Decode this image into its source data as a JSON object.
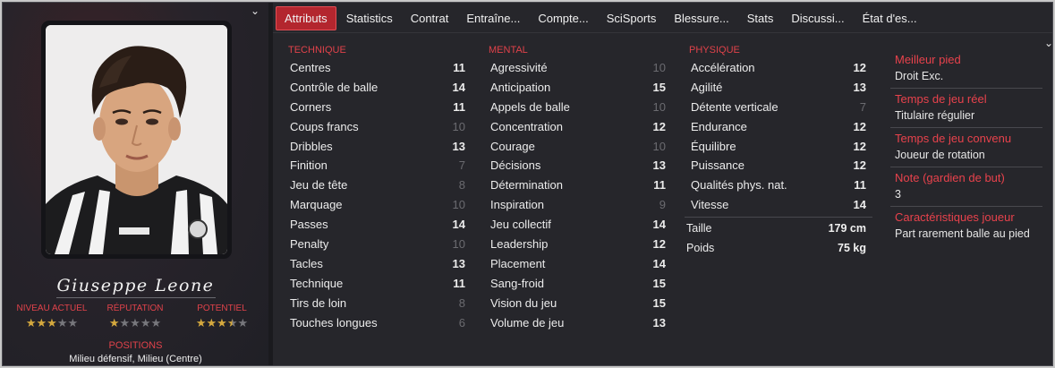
{
  "player": {
    "name": "Giuseppe Leone",
    "ratings": [
      {
        "label": "NIVEAU ACTUEL",
        "stars": 3,
        "of": 5
      },
      {
        "label": "RÉPUTATION",
        "stars": 1,
        "of": 5
      },
      {
        "label": "POTENTIEL",
        "stars": 3.5,
        "of": 5
      }
    ],
    "positions_label": "POSITIONS",
    "positions_value": "Milieu défensif, Milieu (Centre)"
  },
  "tabs": [
    {
      "label": "Attributs",
      "active": true
    },
    {
      "label": "Statistics",
      "active": false
    },
    {
      "label": "Contrat",
      "active": false
    },
    {
      "label": "Entraîne...",
      "active": false
    },
    {
      "label": "Compte...",
      "active": false
    },
    {
      "label": "SciSports",
      "active": false
    },
    {
      "label": "Blessure...",
      "active": false
    },
    {
      "label": "Stats",
      "active": false
    },
    {
      "label": "Discussi...",
      "active": false
    },
    {
      "label": "État d'es...",
      "active": false
    }
  ],
  "attributes": {
    "technique": {
      "title": "TECHNIQUE",
      "items": [
        {
          "name": "Centres",
          "value": 11,
          "dim": false
        },
        {
          "name": "Contrôle de balle",
          "value": 14,
          "dim": false
        },
        {
          "name": "Corners",
          "value": 11,
          "dim": false
        },
        {
          "name": "Coups francs",
          "value": 10,
          "dim": true
        },
        {
          "name": "Dribbles",
          "value": 13,
          "dim": false
        },
        {
          "name": "Finition",
          "value": 7,
          "dim": true
        },
        {
          "name": "Jeu de tête",
          "value": 8,
          "dim": true
        },
        {
          "name": "Marquage",
          "value": 10,
          "dim": true
        },
        {
          "name": "Passes",
          "value": 14,
          "dim": false
        },
        {
          "name": "Penalty",
          "value": 10,
          "dim": true
        },
        {
          "name": "Tacles",
          "value": 13,
          "dim": false
        },
        {
          "name": "Technique",
          "value": 11,
          "dim": false
        },
        {
          "name": "Tirs de loin",
          "value": 8,
          "dim": true
        },
        {
          "name": "Touches longues",
          "value": 6,
          "dim": true
        }
      ]
    },
    "mental": {
      "title": "MENTAL",
      "items": [
        {
          "name": "Agressivité",
          "value": 10,
          "dim": true
        },
        {
          "name": "Anticipation",
          "value": 15,
          "dim": false
        },
        {
          "name": "Appels de balle",
          "value": 10,
          "dim": true
        },
        {
          "name": "Concentration",
          "value": 12,
          "dim": false
        },
        {
          "name": "Courage",
          "value": 10,
          "dim": true
        },
        {
          "name": "Décisions",
          "value": 13,
          "dim": false
        },
        {
          "name": "Détermination",
          "value": 11,
          "dim": false
        },
        {
          "name": "Inspiration",
          "value": 9,
          "dim": true
        },
        {
          "name": "Jeu collectif",
          "value": 14,
          "dim": false
        },
        {
          "name": "Leadership",
          "value": 12,
          "dim": false
        },
        {
          "name": "Placement",
          "value": 14,
          "dim": false
        },
        {
          "name": "Sang-froid",
          "value": 15,
          "dim": false
        },
        {
          "name": "Vision du jeu",
          "value": 15,
          "dim": false
        },
        {
          "name": "Volume de jeu",
          "value": 13,
          "dim": false
        }
      ]
    },
    "physique": {
      "title": "PHYSIQUE",
      "items": [
        {
          "name": "Accélération",
          "value": 12,
          "dim": false
        },
        {
          "name": "Agilité",
          "value": 13,
          "dim": false
        },
        {
          "name": "Détente verticale",
          "value": 7,
          "dim": true
        },
        {
          "name": "Endurance",
          "value": 12,
          "dim": false
        },
        {
          "name": "Équilibre",
          "value": 12,
          "dim": false
        },
        {
          "name": "Puissance",
          "value": 12,
          "dim": false
        },
        {
          "name": "Qualités phys. nat.",
          "value": 11,
          "dim": false
        },
        {
          "name": "Vitesse",
          "value": 14,
          "dim": false
        }
      ],
      "extras": [
        {
          "name": "Taille",
          "value": "179 cm"
        },
        {
          "name": "Poids",
          "value": "75 kg"
        }
      ]
    }
  },
  "info": [
    {
      "label": "Meilleur pied",
      "value": "Droit Exc."
    },
    {
      "label": "Temps de jeu réel",
      "value": "Titulaire régulier"
    },
    {
      "label": "Temps de jeu convenu",
      "value": "Joueur de rotation"
    },
    {
      "label": "Note (gardien de but)",
      "value": "3"
    },
    {
      "label": "Caractéristiques joueur",
      "value": "Part rarement balle au pied"
    }
  ],
  "icons": {
    "collapse": "chevron-down-icon",
    "star": "star-icon"
  },
  "colors": {
    "accent": "#b3262e",
    "label_red": "#e0424a",
    "star_gold": "#d5a93e",
    "background": "#26262b"
  }
}
